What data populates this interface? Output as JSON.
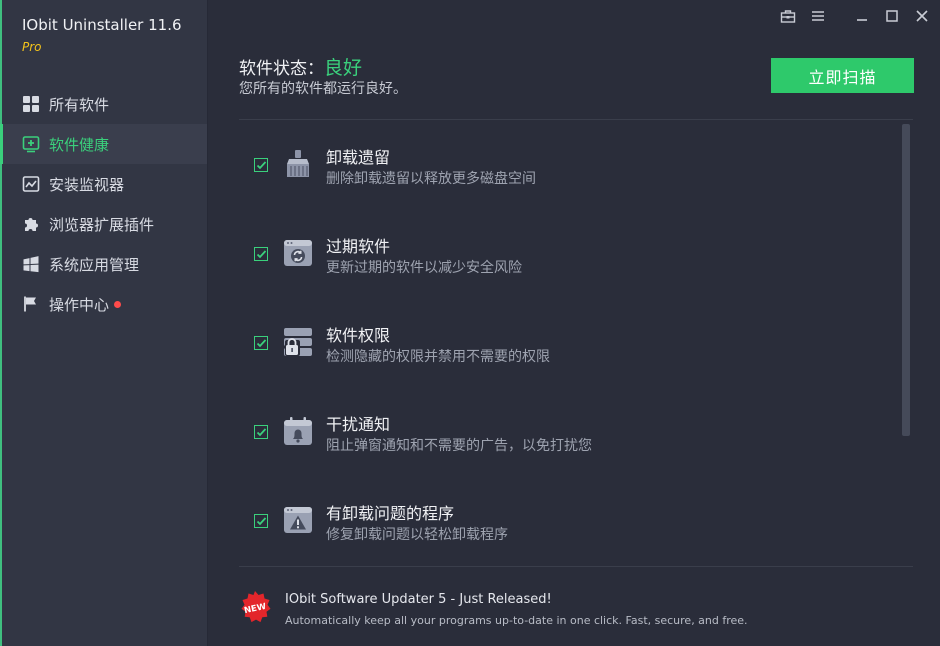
{
  "app": {
    "title": "IObit Uninstaller 11.6",
    "edition": "Pro"
  },
  "sidebar": {
    "items": [
      {
        "label": "所有软件",
        "icon": "grid-icon",
        "active": false
      },
      {
        "label": "软件健康",
        "icon": "health-icon",
        "active": true
      },
      {
        "label": "安装监视器",
        "icon": "monitor-chart-icon",
        "active": false
      },
      {
        "label": "浏览器扩展插件",
        "icon": "puzzle-icon",
        "active": false
      },
      {
        "label": "系统应用管理",
        "icon": "windows-logo-icon",
        "active": false
      },
      {
        "label": "操作中心",
        "icon": "flag-icon",
        "active": false,
        "notification_dot": true
      }
    ]
  },
  "window_controls": [
    "toolbox-icon",
    "menu-icon",
    "minimize-icon",
    "maximize-icon",
    "close-icon"
  ],
  "header": {
    "status_label": "软件状态：",
    "status_value": "良好",
    "status_subtitle": "您所有的软件都运行良好。",
    "scan_button": "立即扫描"
  },
  "health_items": [
    {
      "title": "卸载遗留",
      "description": "删除卸载遗留以释放更多磁盘空间",
      "checked": true,
      "icon": "broom-icon"
    },
    {
      "title": "过期软件",
      "description": "更新过期的软件以减少安全风险",
      "checked": true,
      "icon": "update-window-icon"
    },
    {
      "title": "软件权限",
      "description": "检测隐藏的权限并禁用不需要的权限",
      "checked": true,
      "icon": "permission-lock-icon"
    },
    {
      "title": "干扰通知",
      "description": "阻止弹窗通知和不需要的广告，以免打扰您",
      "checked": true,
      "icon": "notification-bell-icon"
    },
    {
      "title": "有卸载问题的程序",
      "description": "修复卸载问题以轻松卸载程序",
      "checked": true,
      "icon": "warning-window-icon"
    }
  ],
  "promo": {
    "badge_text": "NEW",
    "title": "IObit Software Updater 5 - Just Released!",
    "description": "Automatically keep all your programs up-to-date in one click. Fast, secure, and free."
  },
  "colors": {
    "accent": "#3ad07c",
    "button": "#2ec96b",
    "sidebar_bg": "#323644",
    "main_bg": "#2a2d3a",
    "pro_badge": "#f3c31b"
  }
}
